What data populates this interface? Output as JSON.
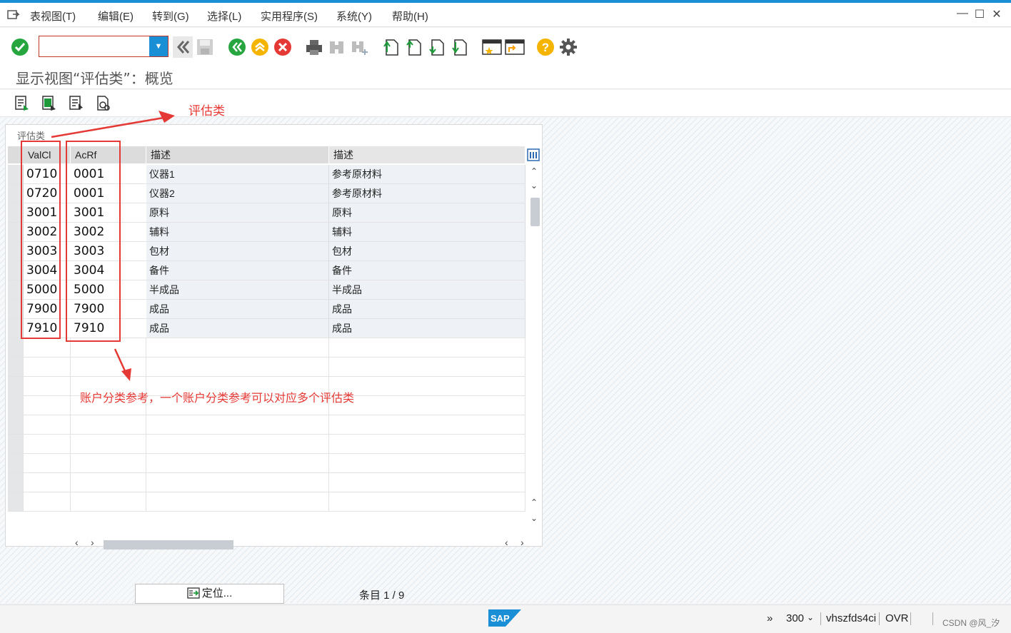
{
  "menu": {
    "items": [
      "表视图(T)",
      "编辑(E)",
      "转到(G)",
      "选择(L)",
      "实用程序(S)",
      "系统(Y)",
      "帮助(H)"
    ]
  },
  "command_field": {
    "value": ""
  },
  "page": {
    "title": "显示视图“评估类”：概览"
  },
  "group": {
    "title": "评估类"
  },
  "table": {
    "columns": [
      "ValCl",
      "AcRf",
      "描述",
      "描述"
    ],
    "rows": [
      {
        "valcl": "0710",
        "acrf": "0001",
        "desc1": "仪器1",
        "desc2": "参考原材料"
      },
      {
        "valcl": "0720",
        "acrf": "0001",
        "desc1": "仪器2",
        "desc2": "参考原材料"
      },
      {
        "valcl": "3001",
        "acrf": "3001",
        "desc1": "原料",
        "desc2": "原料"
      },
      {
        "valcl": "3002",
        "acrf": "3002",
        "desc1": "辅料",
        "desc2": "辅料"
      },
      {
        "valcl": "3003",
        "acrf": "3003",
        "desc1": "包材",
        "desc2": "包材"
      },
      {
        "valcl": "3004",
        "acrf": "3004",
        "desc1": "备件",
        "desc2": "备件"
      },
      {
        "valcl": "5000",
        "acrf": "5000",
        "desc1": "半成品",
        "desc2": "半成品"
      },
      {
        "valcl": "7900",
        "acrf": "7900",
        "desc1": "成品",
        "desc2": "成品"
      },
      {
        "valcl": "7910",
        "acrf": "7910",
        "desc1": "成品",
        "desc2": "成品"
      }
    ]
  },
  "footer": {
    "locate_label": "定位...",
    "entry_label": "条目 1 / 9"
  },
  "status": {
    "client": "300",
    "server": "vhszfds4ci",
    "mode": "OVR",
    "watermark": "CSDN @风_汐"
  },
  "annotations": {
    "label1": "评估类",
    "label2": "账户分类参考，一个账户分类参考可以对应多个评估类"
  },
  "colors": {
    "accent": "#1a8fd6",
    "annotation": "#e53935",
    "ok_green": "#27a640",
    "cancel_red": "#e53935",
    "help_yellow": "#f5b400"
  },
  "icons": [
    "menu-icon",
    "ok-icon",
    "back-all-icon",
    "save-icon",
    "back-icon",
    "exit-icon",
    "cancel-icon",
    "print-icon",
    "find-icon",
    "find-next-icon",
    "first-page-icon",
    "prev-page-icon",
    "next-page-icon",
    "last-page-icon",
    "new-session-icon",
    "shortcut-icon",
    "help-icon",
    "settings-icon"
  ]
}
